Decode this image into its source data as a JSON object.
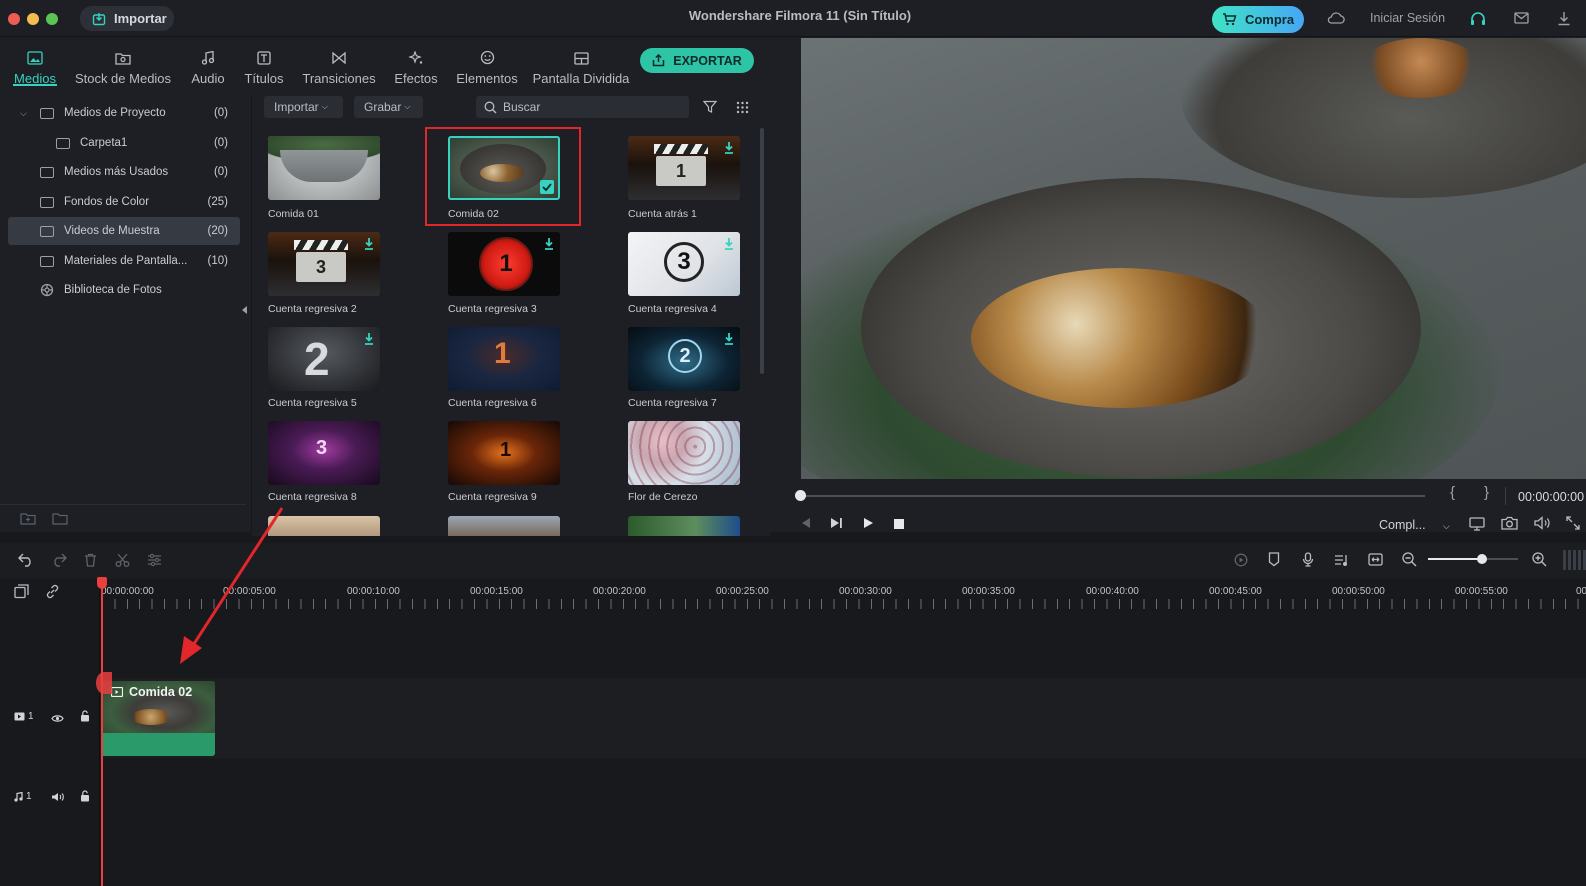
{
  "window": {
    "title": "Wondershare Filmora 11 (Sin Título)",
    "import_button": "Importar",
    "buy_button": "Compra",
    "signin": "Iniciar Sesión",
    "colors": {
      "accent": "#35d3c0",
      "close": "#ee5c56",
      "minimize": "#f3bd4f",
      "zoom": "#5bc455"
    }
  },
  "tabs": [
    {
      "label": "Medios",
      "icon": "media-icon",
      "active": true
    },
    {
      "label": "Stock de Medios",
      "icon": "stock-media-icon"
    },
    {
      "label": "Audio",
      "icon": "audio-icon"
    },
    {
      "label": "Títulos",
      "icon": "titles-icon"
    },
    {
      "label": "Transiciones",
      "icon": "transitions-icon"
    },
    {
      "label": "Efectos",
      "icon": "effects-icon"
    },
    {
      "label": "Elementos",
      "icon": "elements-icon"
    },
    {
      "label": "Pantalla Dividida",
      "icon": "split-screen-icon"
    }
  ],
  "export_button": "EXPORTAR",
  "sidebar": {
    "items": [
      {
        "label": "Medios de Proyecto",
        "count": "(0)",
        "expanded": true
      },
      {
        "label": "Carpeta1",
        "count": "(0)"
      },
      {
        "label": "Medios más Usados",
        "count": "(0)"
      },
      {
        "label": "Fondos de Color",
        "count": "(25)"
      },
      {
        "label": "Videos de Muestra",
        "count": "(20)",
        "selected": true
      },
      {
        "label": "Materiales de Pantalla...",
        "count": "(10)"
      },
      {
        "label": "Biblioteca de Fotos",
        "count": ""
      }
    ]
  },
  "media_toolbar": {
    "import_dropdown": "Importar",
    "record_dropdown": "Grabar",
    "search_placeholder": "Buscar"
  },
  "media_items": [
    {
      "label": "Comida 01"
    },
    {
      "label": "Comida 02",
      "selected": true
    },
    {
      "label": "Cuenta atrás 1"
    },
    {
      "label": "Cuenta regresiva 2"
    },
    {
      "label": "Cuenta regresiva 3"
    },
    {
      "label": "Cuenta regresiva 4"
    },
    {
      "label": "Cuenta regresiva 5"
    },
    {
      "label": "Cuenta regresiva 6"
    },
    {
      "label": "Cuenta regresiva 7"
    },
    {
      "label": "Cuenta regresiva 8"
    },
    {
      "label": "Cuenta regresiva 9"
    },
    {
      "label": "Flor de Cerezo"
    }
  ],
  "preview": {
    "timecode": "00:00:00:00",
    "quality": "Compl...",
    "progress": 0
  },
  "timeline": {
    "ticks": [
      "00:00:00:00",
      "00:00:05:00",
      "00:00:10:00",
      "00:00:15:00",
      "00:00:20:00",
      "00:00:25:00",
      "00:00:30:00",
      "00:00:35:00",
      "00:00:40:00",
      "00:00:45:00",
      "00:00:50:00",
      "00:00:55:00",
      "00"
    ],
    "clip_label": "Comida 02",
    "video_track": "1",
    "audio_track": "1",
    "zoom_level": 0.6
  }
}
